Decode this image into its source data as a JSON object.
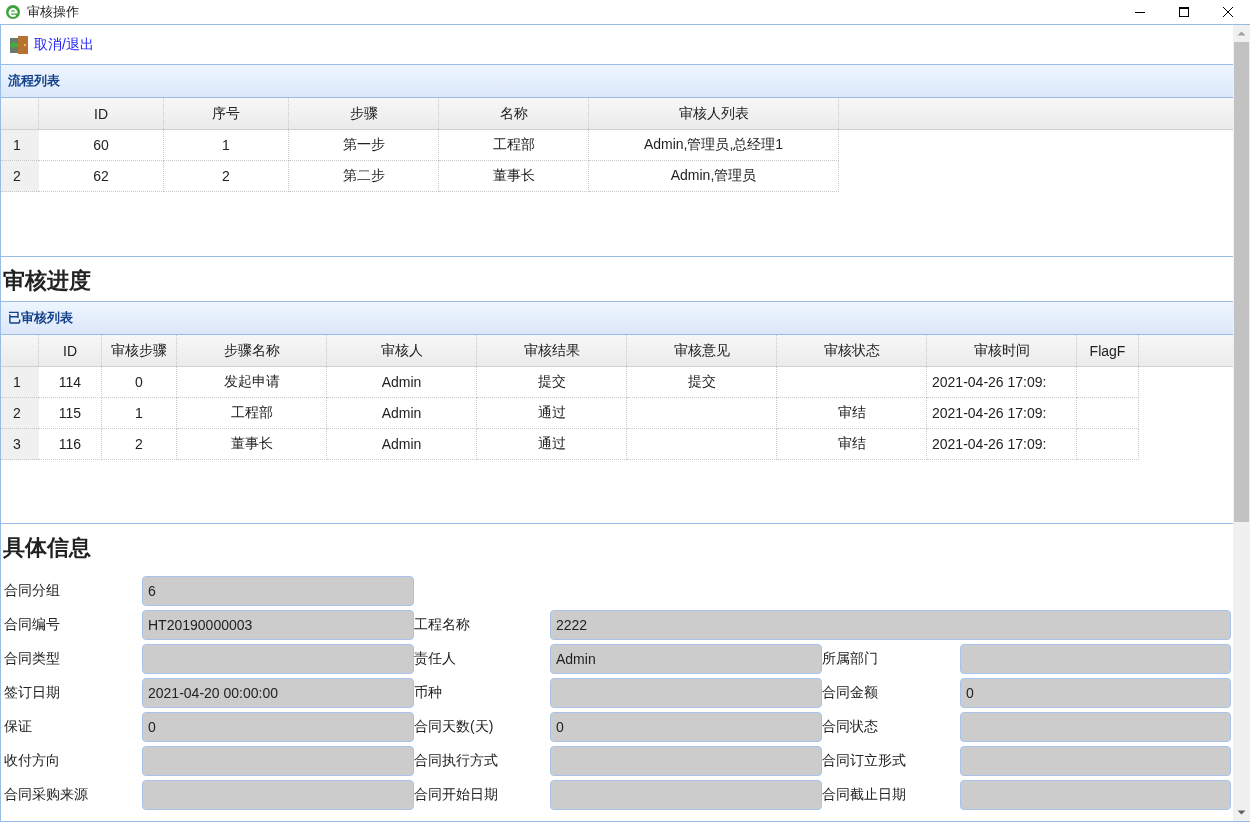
{
  "window": {
    "title": "审核操作"
  },
  "toolbar": {
    "link": "取消/退出"
  },
  "flow_panel": {
    "title": "流程列表",
    "columns": [
      "ID",
      "序号",
      "步骤",
      "名称",
      "审核人列表"
    ],
    "rows": [
      {
        "number": "1",
        "cells": [
          "60",
          "1",
          "第一步",
          "工程部",
          "Admin,管理员,总经理1"
        ]
      },
      {
        "number": "2",
        "cells": [
          "62",
          "2",
          "第二步",
          "董事长",
          "Admin,管理员"
        ]
      }
    ]
  },
  "progress_heading": "审核进度",
  "audit_panel": {
    "title": "已审核列表",
    "columns": [
      "ID",
      "审核步骤",
      "步骤名称",
      "审核人",
      "审核结果",
      "审核意见",
      "审核状态",
      "审核时间",
      "FlagF"
    ],
    "rows": [
      {
        "number": "1",
        "cells": [
          "114",
          "0",
          "发起申请",
          "Admin",
          "提交",
          "提交",
          null,
          "2021-04-26 17:09:",
          null
        ]
      },
      {
        "number": "2",
        "cells": [
          "115",
          "1",
          "工程部",
          "Admin",
          "通过",
          null,
          "审结",
          "2021-04-26 17:09:",
          null
        ]
      },
      {
        "number": "3",
        "cells": [
          "116",
          "2",
          "董事长",
          "Admin",
          "通过",
          null,
          "审结",
          "2021-04-26 17:09:",
          null
        ]
      }
    ]
  },
  "detail_heading": "具体信息",
  "form": {
    "rows": [
      [
        {
          "label": "合同分组",
          "value": "6"
        }
      ],
      [
        {
          "label": "合同编号",
          "value": "HT20190000003"
        },
        {
          "label": "工程名称",
          "value": "2222"
        }
      ],
      [
        {
          "label": "合同类型"
        },
        {
          "label": "责任人",
          "value": "Admin"
        },
        {
          "label": "所属部门"
        }
      ],
      [
        {
          "label": "签订日期",
          "value": "2021-04-20 00:00:00"
        },
        {
          "label": "币种"
        },
        {
          "label": "合同金额",
          "value": "0"
        }
      ],
      [
        {
          "label": "保证",
          "value": "0"
        },
        {
          "label": "合同天数(天)",
          "value": "0"
        },
        {
          "label": "合同状态"
        }
      ],
      [
        {
          "label": "收付方向"
        },
        {
          "label": "合同执行方式"
        },
        {
          "label": "合同订立形式"
        }
      ],
      [
        {
          "label": "合同采购来源"
        },
        {
          "label": "合同开始日期"
        },
        {
          "label": "合同截止日期"
        }
      ]
    ]
  }
}
